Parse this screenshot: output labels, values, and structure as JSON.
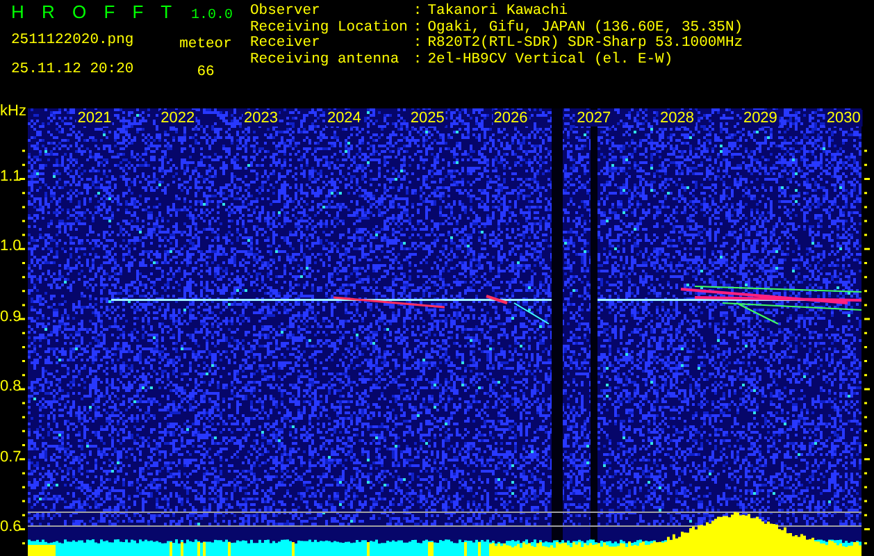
{
  "app": {
    "title": "H R O F F T",
    "version": "1.0.0"
  },
  "file": {
    "name": "2511122020.png",
    "datetime": "25.11.12 20:20"
  },
  "counter": {
    "label": "meteor",
    "value": "66"
  },
  "station": [
    {
      "label": "Observer",
      "separator": ":",
      "value": "Takanori Kawachi"
    },
    {
      "label": "Receiving Location",
      "separator": ":",
      "value": "Ogaki, Gifu, JAPAN (136.60E, 35.35N)"
    },
    {
      "label": "Receiver",
      "separator": ":",
      "value": "R820T2(RTL-SDR) SDR-Sharp 53.1000MHz"
    },
    {
      "label": "Receiving antenna",
      "separator": ":",
      "value": "2el-HB9CV Vertical (el. E-W)"
    }
  ],
  "spectrogram": {
    "unit": "kHz",
    "y_labels": [
      "1.1",
      "1.0",
      "0.9",
      "0.8",
      "0.7",
      "0.6"
    ],
    "x_labels": [
      "2021",
      "2022",
      "2023",
      "2024",
      "2025",
      "2026",
      "2027",
      "2028",
      "2029",
      "2030"
    ]
  }
}
